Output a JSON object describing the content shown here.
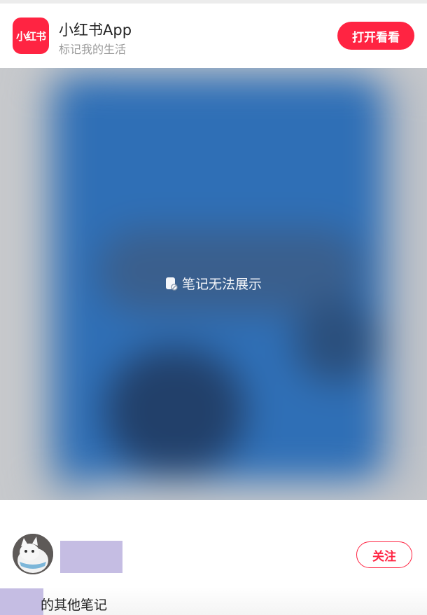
{
  "app_banner": {
    "logo_text": "小红书",
    "name": "小红书App",
    "slogan": "标记我的生活",
    "open_button": "打开看看",
    "brand_color": "#ff2442"
  },
  "media": {
    "notice": "笔记无法展示",
    "notice_icon": "note-unavailable-icon"
  },
  "author": {
    "avatar_icon": "cat-avatar",
    "follow_button": "关注"
  },
  "other_notes": {
    "title_visible_part": "的其他笔记"
  }
}
